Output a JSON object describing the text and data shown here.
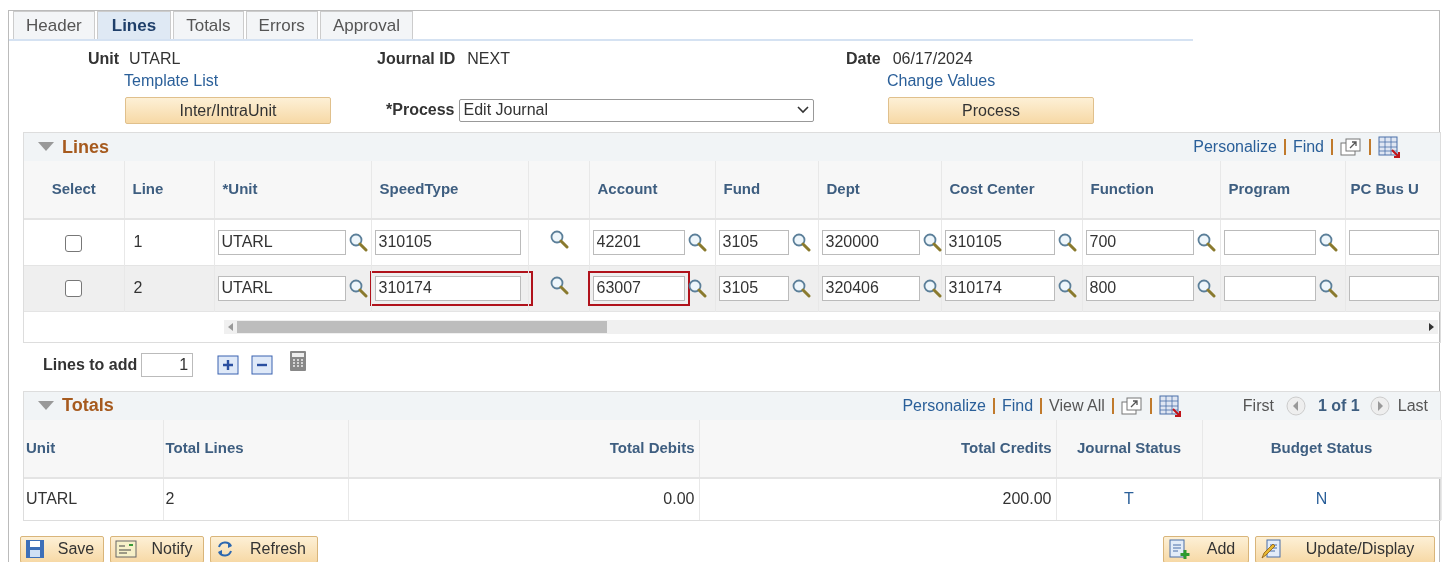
{
  "tabs": [
    {
      "label": "Header",
      "selected": false
    },
    {
      "label": "Lines",
      "selected": true
    },
    {
      "label": "Totals",
      "selected": false
    },
    {
      "label": "Errors",
      "selected": false
    },
    {
      "label": "Approval",
      "selected": false
    }
  ],
  "header": {
    "unit_label": "Unit",
    "unit": "UTARL",
    "template_link": "Template List",
    "inter_button": "Inter/IntraUnit",
    "journal_label": "Journal ID",
    "journal_id": "NEXT",
    "process_label": "*Process",
    "process_value": "Edit Journal",
    "date_label": "Date",
    "date": "06/17/2024",
    "change_link": "Change Values",
    "process_button": "Process"
  },
  "lines": {
    "title": "Lines",
    "links": [
      {
        "text": "Personalize",
        "disabled": false
      },
      {
        "text": "Find",
        "disabled": false
      }
    ],
    "columns": [
      "Select",
      "Line",
      "*Unit",
      "SpeedType",
      "",
      "Account",
      "Fund",
      "Dept",
      "Cost Center",
      "Function",
      "Program",
      "PC Bus U"
    ],
    "rows": [
      {
        "checked": false,
        "line": "1",
        "fields": [
          {
            "kind": "input-lookup",
            "value": "UTARL",
            "highlighted": false
          },
          {
            "kind": "input",
            "value": "310105",
            "highlighted": false
          },
          {
            "kind": "lookup"
          },
          {
            "kind": "input-lookup",
            "value": "42201",
            "highlighted": false
          },
          {
            "kind": "input-lookup",
            "value": "3105",
            "highlighted": false
          },
          {
            "kind": "input-lookup",
            "value": "320000",
            "highlighted": false
          },
          {
            "kind": "input-lookup",
            "value": "310105",
            "highlighted": false
          },
          {
            "kind": "input-lookup",
            "value": "700",
            "highlighted": false
          },
          {
            "kind": "input-lookup",
            "highlighted": false
          },
          {
            "kind": "input",
            "highlighted": false
          }
        ]
      },
      {
        "checked": false,
        "line": "2",
        "fields": [
          {
            "kind": "input-lookup",
            "value": "UTARL",
            "highlighted": false
          },
          {
            "kind": "input",
            "value": "310174",
            "highlighted": true
          },
          {
            "kind": "lookup"
          },
          {
            "kind": "input-lookup",
            "value": "63007",
            "highlighted": true
          },
          {
            "kind": "input-lookup",
            "value": "3105",
            "highlighted": false
          },
          {
            "kind": "input-lookup",
            "value": "320406",
            "highlighted": false
          },
          {
            "kind": "input-lookup",
            "value": "310174",
            "highlighted": false
          },
          {
            "kind": "input-lookup",
            "value": "800",
            "highlighted": false
          },
          {
            "kind": "input-lookup",
            "highlighted": false
          },
          {
            "kind": "input",
            "highlighted": false
          }
        ]
      }
    ],
    "lines_to_add_label": "Lines to add",
    "lines_to_add": "1"
  },
  "totals": {
    "title": "Totals",
    "links": [
      {
        "text": "Personalize",
        "disabled": false
      },
      {
        "text": "Find",
        "disabled": false
      },
      {
        "text": "View All",
        "disabled": true
      }
    ],
    "nav": {
      "first": "First",
      "count": "1 of 1",
      "last": "Last"
    },
    "columns": [
      "Unit",
      "Total Lines",
      "Total Debits",
      "Total Credits",
      "Journal Status",
      "Budget Status"
    ],
    "row": [
      "UTARL",
      "2",
      "0.00",
      "200.00",
      "T",
      "N"
    ]
  },
  "buttons_left": [
    {
      "kind": "save",
      "label": "Save"
    },
    {
      "kind": "notify",
      "label": "Notify"
    },
    {
      "kind": "refresh",
      "label": "Refresh"
    }
  ],
  "buttons_right": [
    {
      "kind": "add",
      "label": "Add"
    },
    {
      "kind": "update",
      "label": "Update/Display"
    }
  ]
}
